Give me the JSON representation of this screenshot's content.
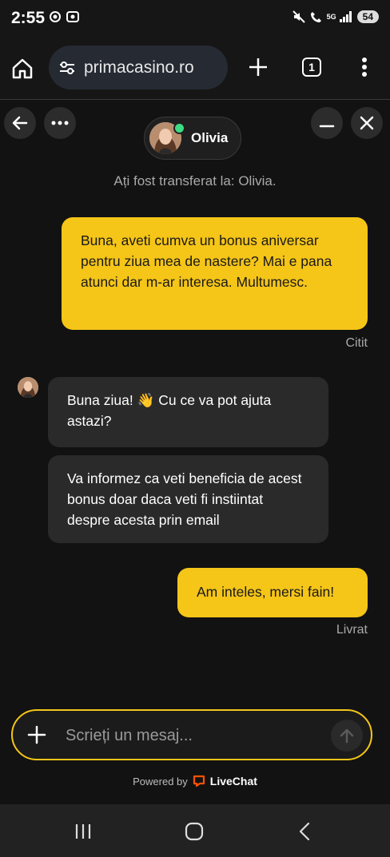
{
  "status_bar": {
    "time": "2:55",
    "network": "5G",
    "battery": "54"
  },
  "browser": {
    "url": "primacasino.ro",
    "tab_count": "1"
  },
  "chat": {
    "agent_name": "Olivia",
    "transfer_notice": "Ați fost transferat la: Olivia.",
    "messages": [
      {
        "from": "user",
        "text": "Buna, aveti cumva un bonus aniversar pentru ziua mea de nastere? Mai e pana atunci dar m-ar interesa. Multumesc.",
        "status": "Citit"
      },
      {
        "from": "agent",
        "text": "Buna ziua! 👋 Cu ce va pot ajuta astazi?"
      },
      {
        "from": "agent",
        "text": "Va informez ca veti beneficia de acest bonus doar daca veti fi instiintat despre acesta prin email"
      },
      {
        "from": "user",
        "text": "Am inteles, mersi fain!",
        "status": "Livrat"
      }
    ],
    "composer_placeholder": "Scrieți un mesaj...",
    "powered_by": "Powered by",
    "brand": "LiveChat"
  },
  "colors": {
    "accent": "#f5c518",
    "background": "#121212",
    "agent_bubble": "#2a2a2a",
    "online": "#3ddc84"
  },
  "icons": [
    "home-icon",
    "tune-icon",
    "plus-icon",
    "tabs-icon",
    "more-vert-icon",
    "back-arrow-icon",
    "more-horiz-icon",
    "minimize-icon",
    "close-icon",
    "send-arrow-icon",
    "livechat-logo-icon",
    "recent-apps-icon",
    "home-nav-icon",
    "back-nav-icon"
  ]
}
